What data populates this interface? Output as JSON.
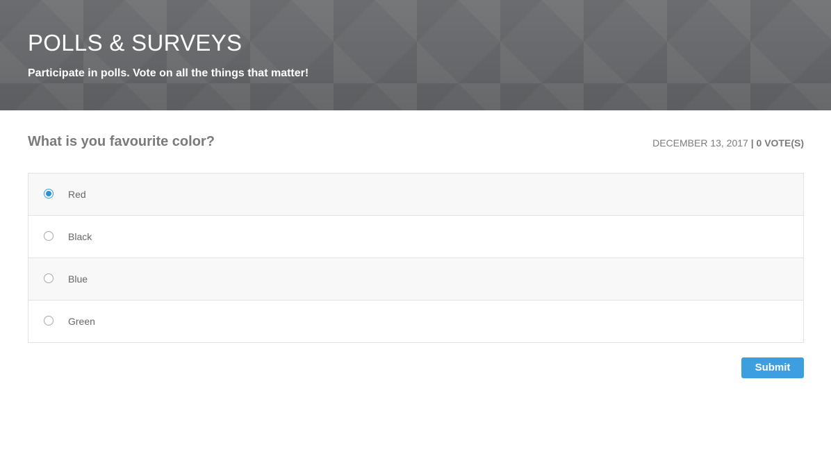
{
  "header": {
    "title": "POLLS & SURVEYS",
    "subtitle": "Participate in polls. Vote on all the things that matter!"
  },
  "poll": {
    "question": "What is you favourite color?",
    "date": "DECEMBER 13, 2017",
    "separator": "|",
    "votes": "0 VOTE(S)",
    "selected_option": "Red",
    "options": [
      {
        "label": "Red",
        "selected": true
      },
      {
        "label": "Black",
        "selected": false
      },
      {
        "label": "Blue",
        "selected": false
      },
      {
        "label": "Green",
        "selected": false
      }
    ],
    "submit_label": "Submit"
  },
  "colors": {
    "accent": "#3d9ee0",
    "header_bg": "#66686b",
    "text_muted": "#7a7a7a"
  },
  "icons": {
    "selected": "radio-checked-icon",
    "unselected": "radio-unchecked-icon"
  }
}
